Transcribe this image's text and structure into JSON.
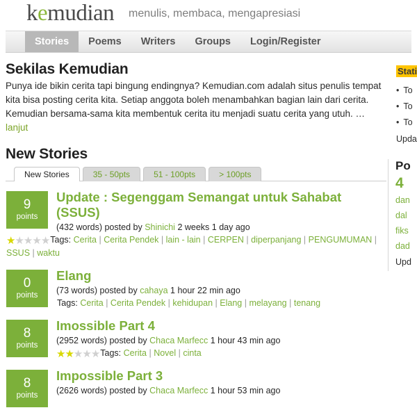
{
  "header": {
    "logo_prefix": "k",
    "logo_highlight": "e",
    "logo_suffix": "mudian",
    "tagline": "menulis, membaca, mengapresiasi",
    "nav": [
      {
        "label": "Stories",
        "active": true
      },
      {
        "label": "Poems",
        "active": false
      },
      {
        "label": "Writers",
        "active": false
      },
      {
        "label": "Groups",
        "active": false
      },
      {
        "label": "Login/Register",
        "active": false
      }
    ]
  },
  "intro": {
    "title": "Sekilas Kemudian",
    "body": "Punya ide bikin cerita tapi bingung endingnya? Kemudian.com adalah situs penulis tempat kita bisa posting cerita kita. Setiap anggota boleh menambahkan bagian lain dari cerita. Kemudian bersama-sama kita membentuk cerita itu menjadi suatu cerita yang utuh. …",
    "more_label": "lanjut"
  },
  "stories_section": {
    "title": "New Stories",
    "tabs": [
      {
        "label": "New Stories",
        "active": true
      },
      {
        "label": "35 - 50pts",
        "active": false
      },
      {
        "label": "51 - 100pts",
        "active": false
      },
      {
        "label": "> 100pts",
        "active": false
      }
    ]
  },
  "stories": [
    {
      "points": "9",
      "points_label": "points",
      "title": "Update : Segenggam Semangat untuk Sahabat (SSUS)",
      "words": "(432 words)",
      "posted_by_label": "posted by",
      "author": "Shinichi",
      "time": "2 weeks 1 day ago",
      "stars": 1,
      "tags_label": "Tags:",
      "tags": [
        "Cerita",
        "Cerita Pendek",
        "lain - lain",
        "CERPEN",
        "diperpanjang",
        "PENGUMUMAN",
        "SSUS",
        "waktu"
      ]
    },
    {
      "points": "0",
      "points_label": "points",
      "title": "Elang",
      "words": "(73 words)",
      "posted_by_label": "posted by",
      "author": "cahaya",
      "time": "1 hour 22 min ago",
      "stars": 0,
      "tags_label": "Tags:",
      "tags": [
        "Cerita",
        "Cerita Pendek",
        "kehidupan",
        "Elang",
        "melayang",
        "tenang"
      ]
    },
    {
      "points": "8",
      "points_label": "points",
      "title": "Imossible Part 4",
      "words": "(2952 words)",
      "posted_by_label": "posted by",
      "author": "Chaca Marfecc",
      "time": "1 hour 43 min ago",
      "stars": 2,
      "tags_label": "Tags:",
      "tags": [
        "Cerita",
        "Novel",
        "cinta"
      ]
    },
    {
      "points": "8",
      "points_label": "points",
      "title": "Impossible Part 3",
      "words": "(2626 words)",
      "posted_by_label": "posted by",
      "author": "Chaca Marfecc",
      "time": "1 hour 53 min ago",
      "stars": 0,
      "tags_label": "Tags:",
      "tags": []
    }
  ],
  "sidebar": {
    "stats_box": {
      "title": "Statis",
      "items": [
        "To",
        "To",
        "To"
      ],
      "note": "Upda"
    },
    "popular_box": {
      "title": "Po",
      "count": "4",
      "links": [
        "dan",
        "dal",
        "fiks",
        "dad"
      ],
      "note": "Upd"
    }
  },
  "colors": {
    "green": "#7cb03a",
    "link_green": "#7cb03a",
    "star_on": "#d8d800",
    "star_off": "#d0d0d0",
    "highlight": "#ffc400",
    "nav_active_bg": "#b8b8b8"
  }
}
